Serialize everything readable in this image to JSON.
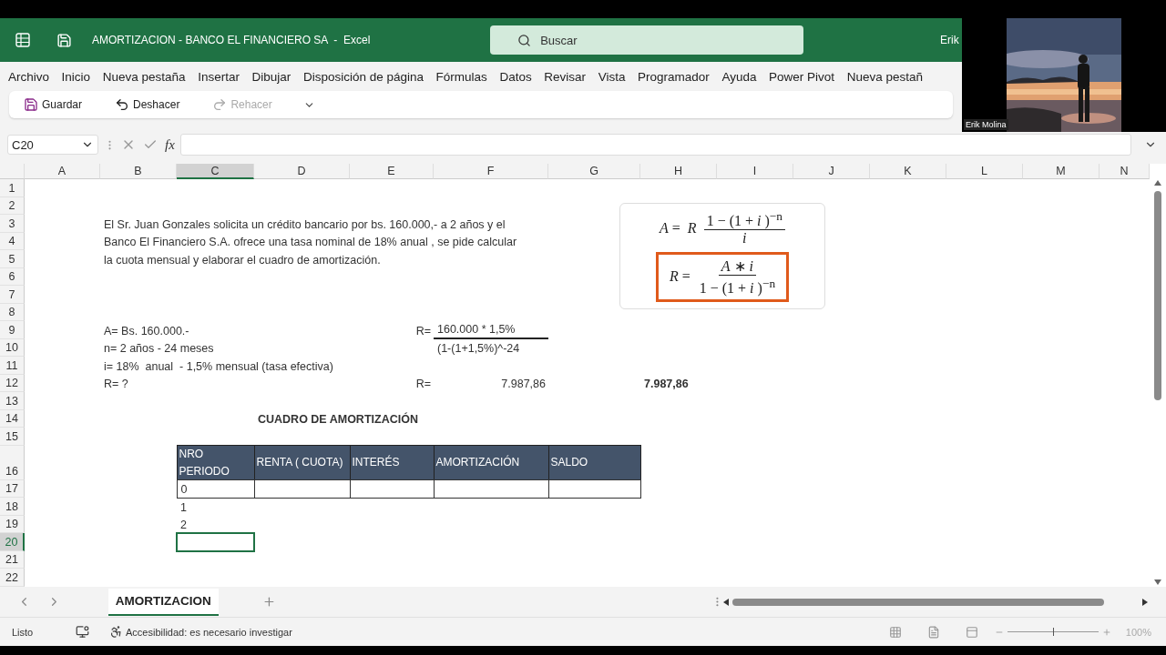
{
  "title_bar": {
    "title": "AMORTIZACION - BANCO EL FINANCIERO SA  -  Excel",
    "search": {
      "placeholder": "Buscar"
    },
    "user": "Erik"
  },
  "ribbon_tabs": [
    "Archivo",
    "Inicio",
    "Nueva pestaña",
    "Insertar",
    "Dibujar",
    "Disposición de página",
    "Fórmulas",
    "Datos",
    "Revisar",
    "Vista",
    "Programador",
    "Ayuda",
    "Power Pivot",
    "Nueva pestañ"
  ],
  "quick_toolbar": [
    {
      "kind": "save",
      "label": "Guardar",
      "disabled": false
    },
    {
      "kind": "undo",
      "label": "Deshacer",
      "disabled": false
    },
    {
      "kind": "redo",
      "label": "Rehacer",
      "disabled": true
    }
  ],
  "formula_bar": {
    "name_box": "C20",
    "function_label": "fx"
  },
  "columns": [
    {
      "label": "A",
      "selected": false
    },
    {
      "label": "B",
      "selected": false
    },
    {
      "label": "C",
      "selected": true
    },
    {
      "label": "D",
      "selected": false
    },
    {
      "label": "E",
      "selected": false
    },
    {
      "label": "F",
      "selected": false
    },
    {
      "label": "G",
      "selected": false
    },
    {
      "label": "H",
      "selected": false
    },
    {
      "label": "I",
      "selected": false
    },
    {
      "label": "J",
      "selected": false
    },
    {
      "label": "K",
      "selected": false
    },
    {
      "label": "L",
      "selected": false
    },
    {
      "label": "M",
      "selected": false
    },
    {
      "label": "N",
      "selected": false
    }
  ],
  "rows": [
    {
      "number": "1",
      "selected": false
    },
    {
      "number": "2",
      "selected": false
    },
    {
      "number": "3",
      "selected": false,
      "cells": {
        "B": {
          "kind": "text",
          "text": "El Sr. Juan Gonzales solicita un crédito bancario por bs. 160.000,- a 2 años y el"
        }
      }
    },
    {
      "number": "4",
      "selected": false,
      "cells": {
        "B": {
          "kind": "text",
          "text": "Banco El Financiero S.A. ofrece una tasa nominal de 18% anual , se pide calcular"
        }
      }
    },
    {
      "number": "5",
      "selected": false,
      "cells": {
        "B": {
          "kind": "text",
          "text": "la cuota mensual y elaborar el cuadro de amortización."
        }
      }
    },
    {
      "number": "6",
      "selected": false
    },
    {
      "number": "7",
      "selected": false
    },
    {
      "number": "8",
      "selected": false
    },
    {
      "number": "9",
      "selected": false,
      "cells": {
        "B": {
          "kind": "text",
          "text": "A= Bs. 160.000.-"
        },
        "E": {
          "kind": "number",
          "text": "R="
        },
        "F": {
          "kind": "numerator",
          "text": "160.000 * 1,5%"
        }
      }
    },
    {
      "number": "10",
      "selected": false,
      "cells": {
        "B": {
          "kind": "text",
          "text": "n= 2 años - 24 meses"
        },
        "F": {
          "kind": "text",
          "text": "(1-(1+1,5%)^-24"
        }
      }
    },
    {
      "number": "11",
      "selected": false,
      "cells": {
        "B": {
          "kind": "text",
          "text": "i= 18%  anual  - 1,5% mensual (tasa efectiva)"
        }
      }
    },
    {
      "number": "12",
      "selected": false,
      "cells": {
        "B": {
          "kind": "text",
          "text": "R= ?"
        },
        "E": {
          "kind": "number",
          "text": "R="
        },
        "F": {
          "kind": "number",
          "text": "7.987,86"
        },
        "H": {
          "kind": "total",
          "text": "7.987,86"
        }
      }
    },
    {
      "number": "13",
      "selected": false
    },
    {
      "number": "14",
      "selected": false,
      "cells": {
        "D": {
          "kind": "title",
          "text": "CUADRO DE AMORTIZACIÓN"
        }
      }
    },
    {
      "number": "15",
      "selected": false
    },
    {
      "number": "16",
      "selected": false,
      "cells": {
        "C": {
          "kind": "header",
          "text": "NRO\nPERIODO"
        },
        "D": {
          "kind": "header",
          "text": "RENTA ( CUOTA)"
        },
        "E": {
          "kind": "header",
          "text": "INTERÉS"
        },
        "F": {
          "kind": "header",
          "text": "AMORTIZACIÓN"
        },
        "G": {
          "kind": "header",
          "text": "SALDO"
        }
      }
    },
    {
      "number": "17",
      "selected": false,
      "cells": {
        "C": {
          "kind": "bordered",
          "text": "0"
        },
        "D": {
          "kind": "bordered"
        },
        "E": {
          "kind": "bordered"
        },
        "F": {
          "kind": "bordered"
        },
        "G": {
          "kind": "bordered"
        }
      }
    },
    {
      "number": "18",
      "selected": false,
      "cells": {
        "C": {
          "kind": "text",
          "text": "1"
        }
      }
    },
    {
      "number": "19",
      "selected": false,
      "cells": {
        "C": {
          "kind": "text",
          "text": "2"
        }
      }
    },
    {
      "number": "20",
      "selected": true
    },
    {
      "number": "21",
      "selected": false
    },
    {
      "number": "22",
      "selected": false
    }
  ],
  "formula_image": {
    "top": {
      "lhs": "*A* =",
      "factor": "*R*",
      "numerator": "1 − (1 + *i* )$^{−n}$",
      "denominator": "*i*"
    },
    "boxed": {
      "lhs": "*R* =",
      "numerator": "*A* ∗ *i*",
      "denominator": "1 − (1 + *i* )$^{−n}$"
    }
  },
  "sheet_tabs": [
    {
      "label": "AMORTIZACION",
      "selected": true
    }
  ],
  "status_bar": {
    "status": "Listo",
    "accessibility": "Accesibilidad: es necesario investigar",
    "zoom": "100%",
    "zoom_slider": {
      "level": 0.5
    }
  },
  "webcam": {
    "name": "Erik Molina"
  }
}
